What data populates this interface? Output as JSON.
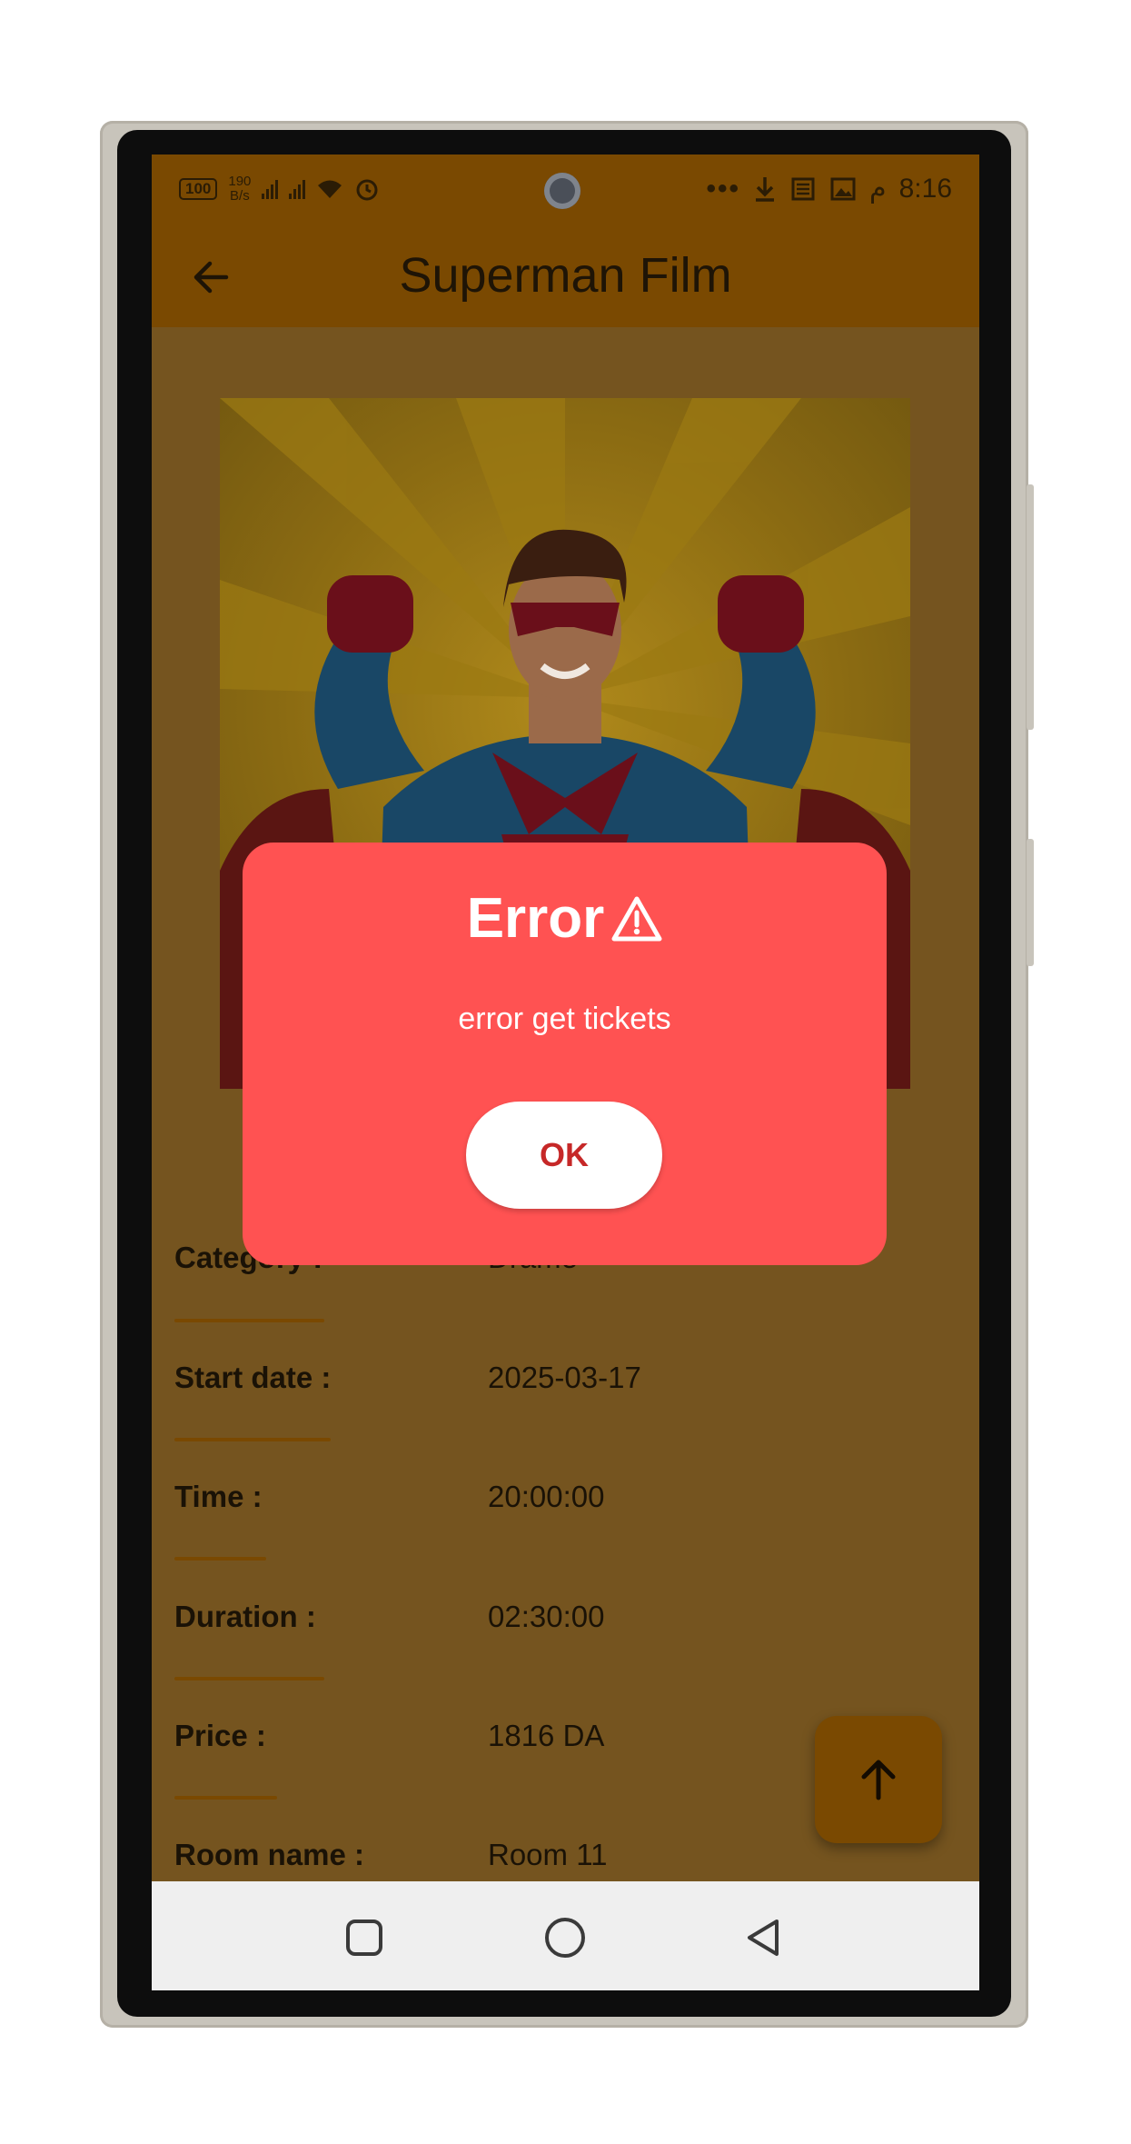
{
  "status_bar": {
    "battery": "100",
    "net_speed_value": "190",
    "net_speed_unit": "B/s",
    "time": "8:16",
    "am_pm": "م"
  },
  "app_bar": {
    "title": "Superman Film",
    "back_icon": "arrow-left-icon"
  },
  "details": [
    {
      "label": "Category :",
      "value": "Drame"
    },
    {
      "label": "Start date :",
      "value": "2025-03-17"
    },
    {
      "label": "Time :",
      "value": "20:00:00"
    },
    {
      "label": "Duration :",
      "value": "02:30:00"
    },
    {
      "label": "Price :",
      "value": "1816 DA"
    },
    {
      "label": "Room name :",
      "value": "Room 11"
    }
  ],
  "dialog": {
    "title": "Error",
    "title_icon": "warning-icon",
    "message": "error get tickets",
    "ok_label": "OK"
  },
  "fab": {
    "icon": "arrow-up-icon"
  },
  "colors": {
    "app_bar": "#7a4901",
    "dialog_bg": "#ff5252",
    "ok_text": "#c62828",
    "accent_line": "#7a4901"
  }
}
